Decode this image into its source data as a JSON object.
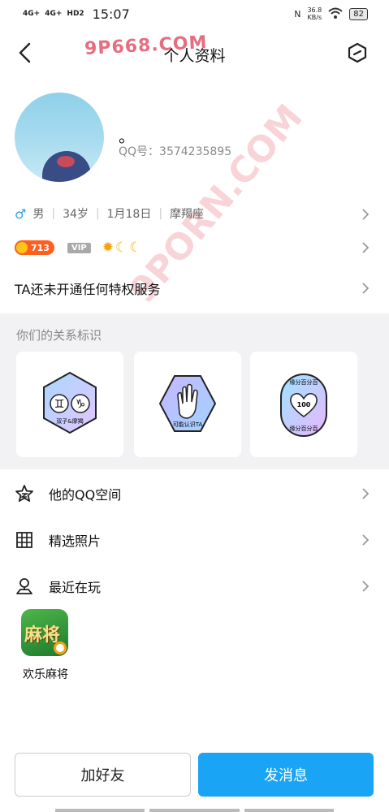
{
  "status_bar": {
    "signal1": "4G+",
    "signal2": "4G+",
    "hd": "HD2",
    "time": "15:07",
    "nfc": "N",
    "speed": "36.8",
    "speed_unit": "KB/s",
    "battery": "82"
  },
  "nav": {
    "title": "个人资料",
    "watermark": "9P668.COM"
  },
  "profile": {
    "nickname": "。",
    "qq_number": "QQ号：3574235895"
  },
  "basic_info": {
    "gender_icon": "♂",
    "gender": "男",
    "age": "34岁",
    "birthday": "1月18日",
    "constellation": "摩羯座"
  },
  "badges": {
    "coin_value": "713",
    "vip_label": "VIP"
  },
  "privilege_text": "TA还未开通任何特权服务",
  "relation": {
    "title": "你们的关系标识",
    "cards": [
      {
        "label": "双子&摩羯",
        "sym1": "♊",
        "sym2": "♑"
      },
      {
        "label": "可能认识TA"
      },
      {
        "label": "缘分百分百",
        "num": "100"
      }
    ]
  },
  "list": {
    "qzone": "他的QQ空间",
    "photos": "精选照片",
    "recent": "最近在玩"
  },
  "game": {
    "icon_text": "麻将",
    "name": "欢乐麻将"
  },
  "watermark_big": "9PORN.COM",
  "buttons": {
    "add_friend": "加好友",
    "send_message": "发消息"
  },
  "colors": {
    "accent": "#1aa4f5",
    "coin": "#ff5e1f",
    "male": "#2fa3e6"
  }
}
